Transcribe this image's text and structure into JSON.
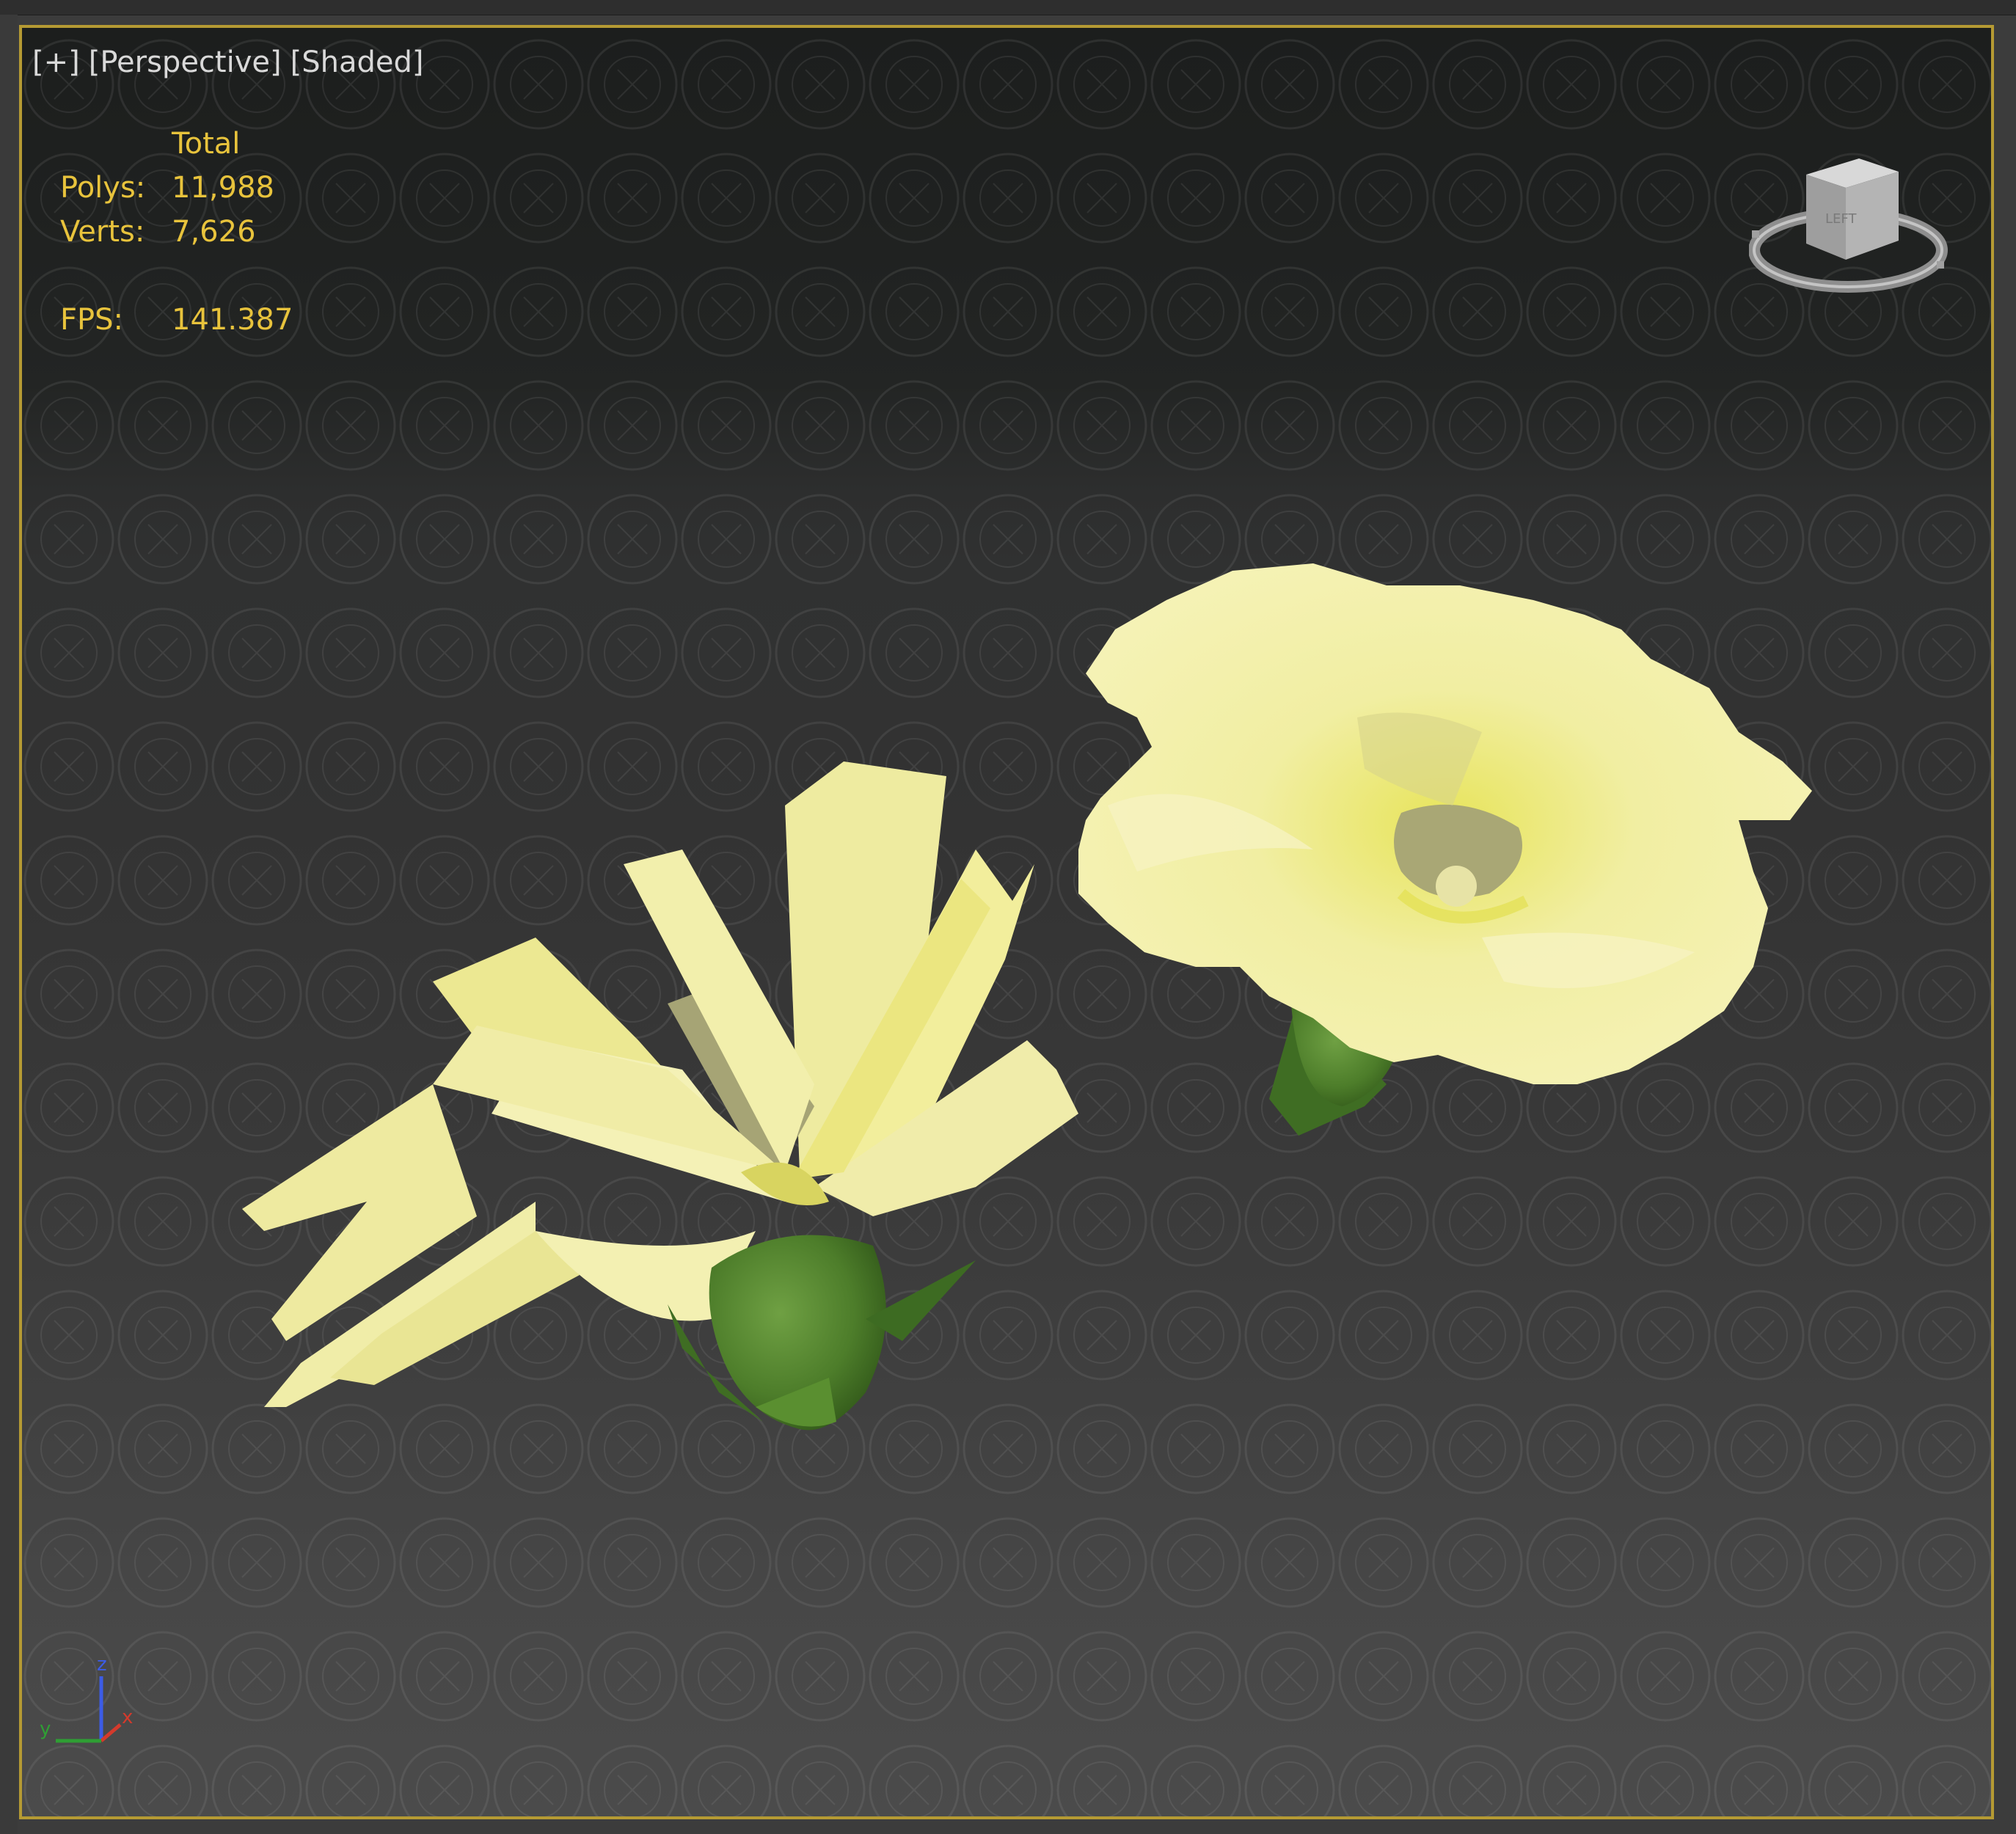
{
  "viewport": {
    "labels": [
      "[+]",
      "[Perspective]",
      "[Shaded]"
    ],
    "stats": {
      "header": "Total",
      "polys_label": "Polys:",
      "polys_value": "11,988",
      "verts_label": "Verts:",
      "verts_value": "7,626",
      "fps_label": "FPS:",
      "fps_value": "141.387"
    },
    "viewcube": {
      "face_label": "LEFT",
      "icon": "viewcube-icon"
    },
    "axis": {
      "x": "x",
      "y": "y",
      "z": "z"
    }
  },
  "colors": {
    "frame_border": "#b59a33",
    "stats_text": "#e8c33c",
    "label_text": "#d9d9d9",
    "petal": "#f2efa4",
    "petal_shadow": "#a8a573",
    "stem": "#4f7f2b"
  }
}
